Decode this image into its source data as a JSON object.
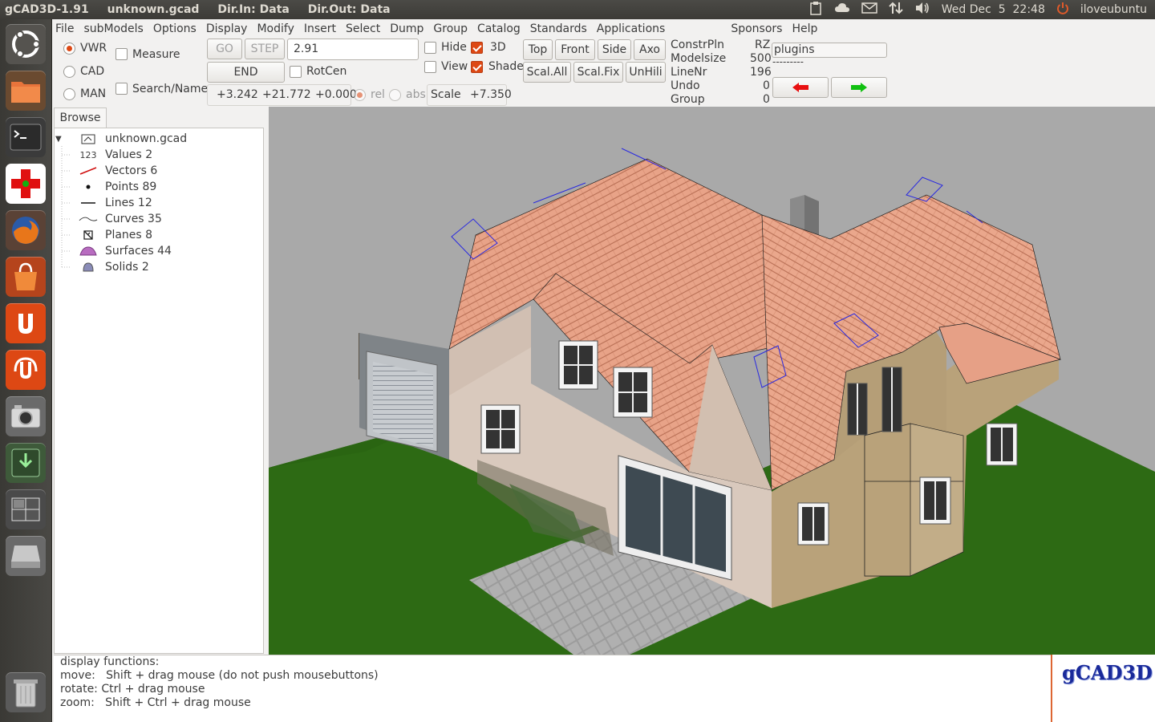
{
  "window": {
    "title_app": "gCAD3D-1.91",
    "title_file": "unknown.gcad",
    "dir_in": "Dir.In: Data",
    "dir_out": "Dir.Out: Data"
  },
  "panel": {
    "datetime": "Wed Dec  5  22:48",
    "user": "iloveubuntu"
  },
  "launcher": [
    {
      "name": "dash-home-icon"
    },
    {
      "name": "files-icon"
    },
    {
      "name": "terminal-icon"
    },
    {
      "name": "gcad3d-icon"
    },
    {
      "name": "firefox-icon"
    },
    {
      "name": "software-center-icon"
    },
    {
      "name": "ubuntu-one-icon"
    },
    {
      "name": "ubuntu-one-music-icon"
    },
    {
      "name": "camera-icon"
    },
    {
      "name": "update-manager-icon"
    },
    {
      "name": "workspace-switcher-icon"
    },
    {
      "name": "drive-icon"
    },
    {
      "name": "trash-icon"
    }
  ],
  "menu": [
    "File",
    "subModels",
    "Options",
    "Display",
    "Modify",
    "Insert",
    "Select",
    "Dump",
    "Group",
    "Catalog",
    "Standards",
    "Applications",
    "Sponsors",
    "Help"
  ],
  "toolbar": {
    "mode_vwr": "VWR",
    "mode_cad": "CAD",
    "mode_man": "MAN",
    "measure": "Measure",
    "search_name": "Search/Name",
    "go": "GO",
    "step": "STEP",
    "step_value": "2.91",
    "end": "END",
    "rotcen": "RotCen",
    "coord_x": "+3.242",
    "coord_y": "+21.772",
    "coord_z": "+0.000",
    "rel": "rel",
    "abs": "abs",
    "scale_label": "Scale",
    "scale_value": "+7.350",
    "hide": "Hide",
    "view": "View",
    "three_d": "3D",
    "shade": "Shade",
    "top": "Top",
    "front": "Front",
    "side": "Side",
    "axo": "Axo",
    "scal_all": "Scal.All",
    "scal_fix": "Scal.Fix",
    "unhili": "UnHili",
    "constrpln_label": "ConstrPln",
    "constrpln_value": "RZ",
    "modelsize_label": "Modelsize",
    "modelsize_value": "500",
    "linenr_label": "LineNr",
    "linenr_value": "196",
    "undo_label": "Undo",
    "undo_value": "0",
    "group_label": "Group",
    "group_value": "0",
    "plugins_value": "plugins",
    "plugins_sub": "---------"
  },
  "browser": {
    "tab": "Browse",
    "root": "unknown.gcad",
    "items": [
      {
        "label": "Values 2",
        "icon": "values-icon",
        "glyph": "123"
      },
      {
        "label": "Vectors 6",
        "icon": "vector-icon",
        "glyph": ""
      },
      {
        "label": "Points 89",
        "icon": "point-icon",
        "glyph": ""
      },
      {
        "label": "Lines 12",
        "icon": "line-icon",
        "glyph": ""
      },
      {
        "label": "Curves 35",
        "icon": "curve-icon",
        "glyph": ""
      },
      {
        "label": "Planes 8",
        "icon": "plane-icon",
        "glyph": ""
      },
      {
        "label": "Surfaces 44",
        "icon": "surface-icon",
        "glyph": ""
      },
      {
        "label": "Solids 2",
        "icon": "solid-icon",
        "glyph": ""
      }
    ]
  },
  "messages": {
    "line1": "display functions:",
    "line2": "move:   Shift + drag mouse (do not push mousebuttons)",
    "line3": "rotate: Ctrl + drag mouse",
    "line4": "zoom:   Shift + Ctrl + drag mouse"
  },
  "logo": "gCAD3D",
  "colors": {
    "accent": "#dd4814",
    "grass": "#2d6a14",
    "roof": "#e8a388",
    "wall": "#d9c9bd",
    "viewport_bg": "#a9a9a9"
  }
}
